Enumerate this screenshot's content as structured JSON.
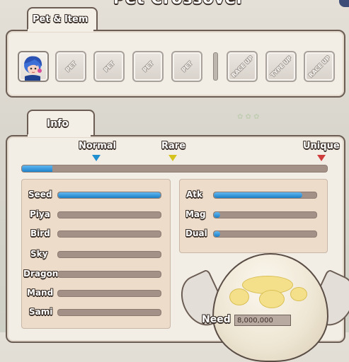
{
  "header": {
    "title": "Pet Crossover"
  },
  "pet_item": {
    "tab_label": "Pet & Item",
    "slots": [
      {
        "type": "avatar",
        "icon": "blue-haired-character-icon"
      },
      {
        "type": "locked",
        "label": "PET"
      },
      {
        "type": "locked",
        "label": "PET"
      },
      {
        "type": "locked",
        "label": "PET"
      },
      {
        "type": "locked",
        "label": "PET"
      },
      {
        "type": "locked",
        "label": "RACE UP"
      },
      {
        "type": "locked",
        "label": "TYPE UP"
      },
      {
        "type": "locked",
        "label": "RACE UP"
      }
    ]
  },
  "info": {
    "tab_label": "Info",
    "grades": {
      "normal": {
        "label": "Normal",
        "color": "#1f8fd0"
      },
      "rare": {
        "label": "Rare",
        "color": "#d6c21c"
      },
      "unique": {
        "label": "Unique",
        "color": "#cf3c3c"
      }
    },
    "rarity_progress": 0.1,
    "races": [
      {
        "label": "Seed",
        "value": 1.0
      },
      {
        "label": "Piya",
        "value": 0
      },
      {
        "label": "Bird",
        "value": 0
      },
      {
        "label": "Sky",
        "value": 0
      },
      {
        "label": "Dragon",
        "value": 0
      },
      {
        "label": "Mand",
        "value": 0
      },
      {
        "label": "Sami",
        "value": 0
      }
    ],
    "types": [
      {
        "label": "Atk",
        "value": 0.86
      },
      {
        "label": "Mag",
        "value": 0.06
      },
      {
        "label": "Dual",
        "value": 0.06
      }
    ],
    "need_label": "Need",
    "need_value": "8,000,000"
  },
  "colors": {
    "accent_blue": "#1f83cb",
    "track": "#a39188",
    "panel": "#f3eee5"
  }
}
